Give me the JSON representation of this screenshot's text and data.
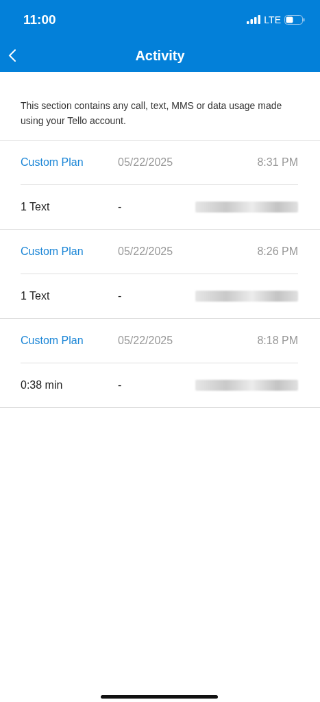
{
  "status_bar": {
    "time": "11:00",
    "network": "LTE"
  },
  "nav": {
    "title": "Activity"
  },
  "description": "This section contains any call, text, MMS or data usage made using your Tello account.",
  "entries": [
    {
      "plan": "Custom Plan",
      "date": "05/22/2025",
      "time": "8:31 PM",
      "usage": "1 Text",
      "dash": "-"
    },
    {
      "plan": "Custom Plan",
      "date": "05/22/2025",
      "time": "8:26 PM",
      "usage": "1 Text",
      "dash": "-"
    },
    {
      "plan": "Custom Plan",
      "date": "05/22/2025",
      "time": "8:18 PM",
      "usage": "0:38 min",
      "dash": "-"
    }
  ]
}
